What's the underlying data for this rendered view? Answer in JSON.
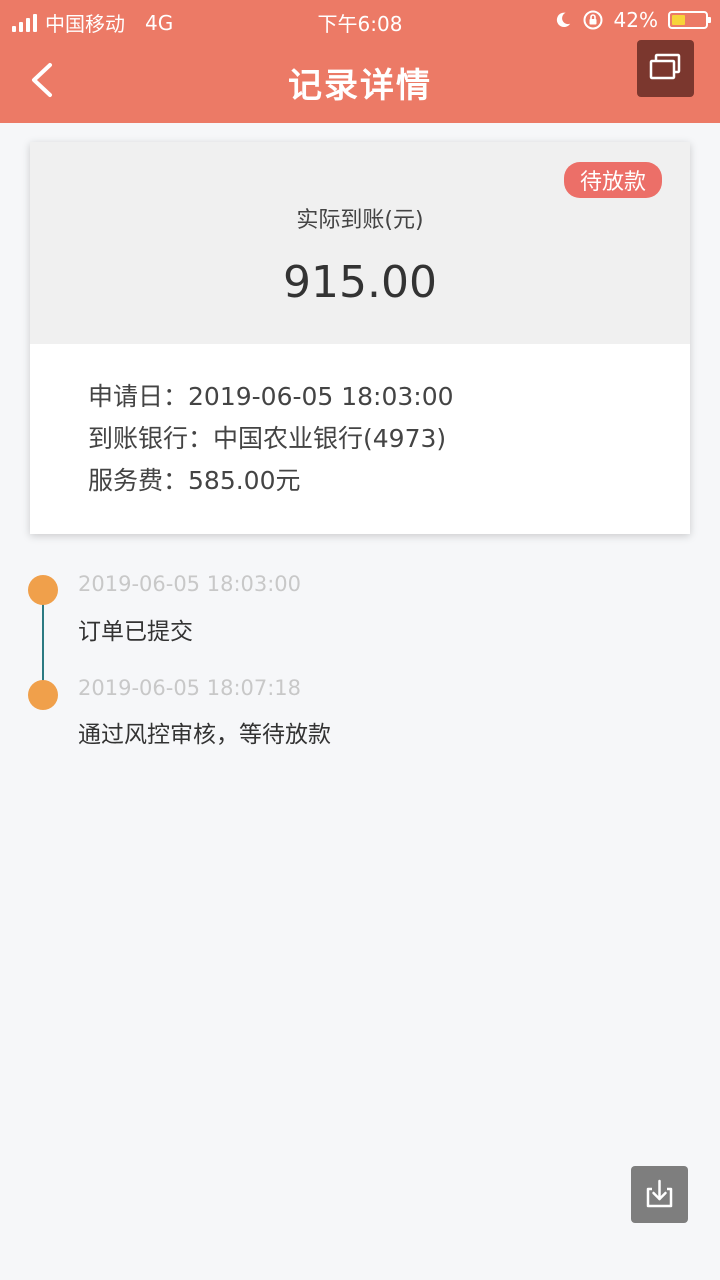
{
  "status_bar": {
    "carrier": "中国移动",
    "network": "4G",
    "time": "下午6:08",
    "battery": "42%",
    "battery_level": 0.42
  },
  "nav": {
    "title": "记录详情"
  },
  "card": {
    "status_badge": "待放款",
    "amount_label": "实际到账(元)",
    "amount_value": "915.00",
    "details": [
      {
        "label": "申请日：",
        "value": "2019-06-05 18:03:00"
      },
      {
        "label": "到账银行：",
        "value": "中国农业银行(4973)"
      },
      {
        "label": "服务费：",
        "value": "585.00元"
      }
    ]
  },
  "timeline": [
    {
      "time": "2019-06-05 18:03:00",
      "desc": "订单已提交"
    },
    {
      "time": "2019-06-05 18:07:18",
      "desc": "通过风控审核，等待放款"
    }
  ],
  "colors": {
    "header": "#ec7a66",
    "badge": "#ec6f68",
    "timeline_dot": "#f0a04b",
    "timeline_line": "#2c7a82"
  }
}
